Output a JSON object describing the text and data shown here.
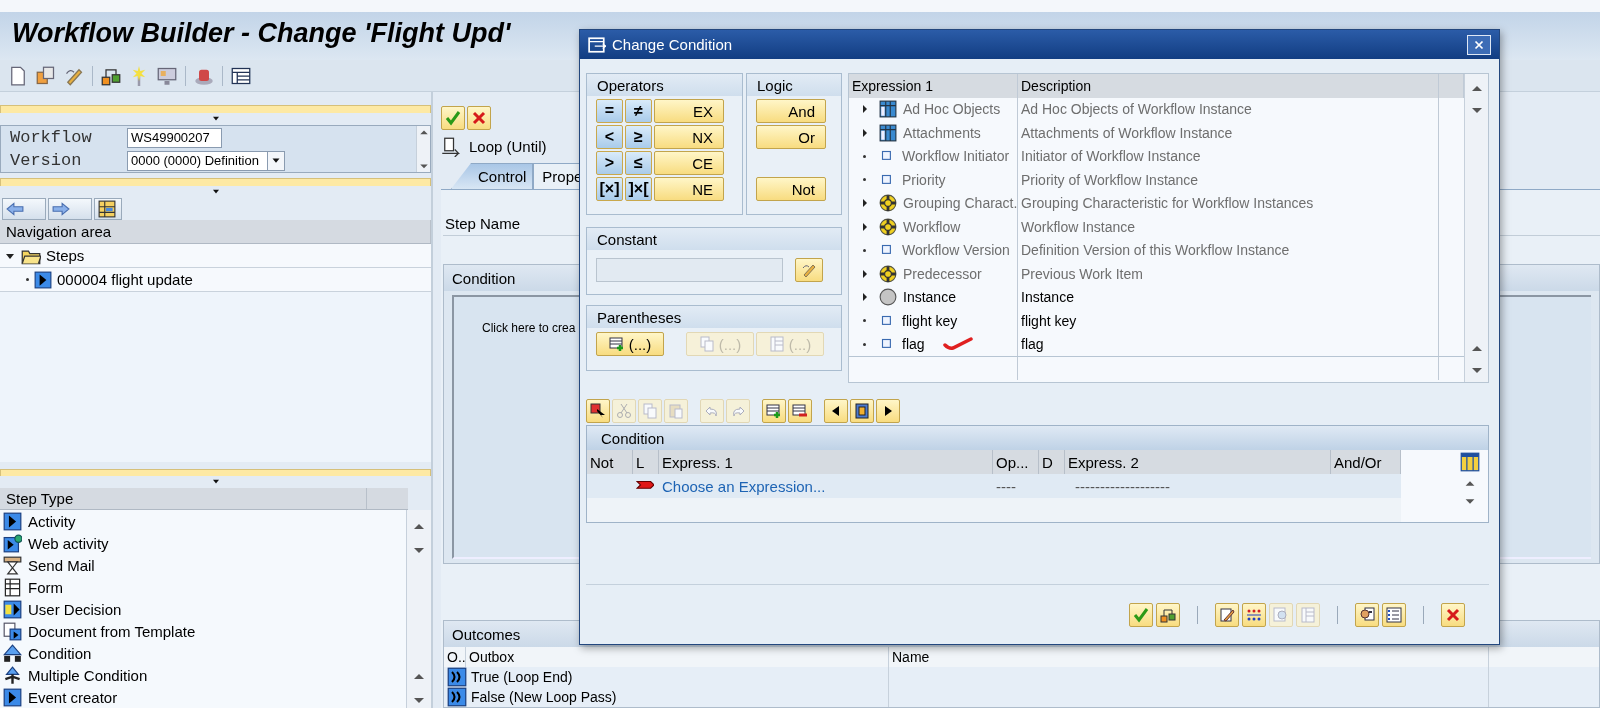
{
  "app_title": "Workflow Builder - Change 'Flight Upd'",
  "left_panel": {
    "form": [
      {
        "label": "Workflow",
        "value": "WS49900207",
        "kind": "text"
      },
      {
        "label": "Version",
        "value": "0000 (0000) Definition",
        "kind": "dropdown"
      }
    ],
    "navigation": {
      "title": "Navigation area",
      "tree": [
        {
          "label": "Steps",
          "expanded": true,
          "children": [
            {
              "label": "000004 flight update"
            }
          ]
        }
      ]
    },
    "step_types": {
      "title": "Step Type",
      "items": [
        "Activity",
        "Web activity",
        "Send Mail",
        "Form",
        "User Decision",
        "Document from Template",
        "Condition",
        "Multiple Condition",
        "Event creator"
      ]
    }
  },
  "detail": {
    "step_title": "Loop (Until)",
    "tabs": [
      {
        "label": "Control",
        "selected": true
      },
      {
        "label": "Prope",
        "selected": false
      }
    ],
    "step_name_label": "Step Name",
    "condition_title": "Condition",
    "condition_hint": "Click here to crea",
    "outcomes": {
      "title": "Outcomes",
      "columns": [
        "O..",
        "Outbox",
        "Name"
      ],
      "rows": [
        "True (Loop End)",
        "False (New Loop Pass)"
      ]
    }
  },
  "dialog": {
    "title": "Change Condition",
    "operators": {
      "title": "Operators",
      "rows": [
        {
          "symbols": [
            "=",
            "≠"
          ],
          "button": "EX"
        },
        {
          "symbols": [
            "<",
            "≥"
          ],
          "button": "NX"
        },
        {
          "symbols": [
            ">",
            "≤"
          ],
          "button": "CE"
        },
        {
          "symbols": [
            "[×]",
            "]×["
          ],
          "button": "NE"
        }
      ]
    },
    "logic": {
      "title": "Logic",
      "buttons": [
        "And",
        "Or",
        "Not"
      ]
    },
    "constant": {
      "title": "Constant"
    },
    "parentheses": {
      "title": "Parentheses",
      "buttons": [
        {
          "label": "(...)",
          "disabled": false
        },
        {
          "label": "(...)",
          "disabled": true
        },
        {
          "label": "(...)",
          "disabled": true
        }
      ]
    },
    "expressions": {
      "columns": [
        "Expression 1",
        "Description"
      ],
      "rows": [
        {
          "label": "Ad Hoc Objects",
          "description": "Ad Hoc Objects of Workflow Instance",
          "kind": "table",
          "has_children": true,
          "disabled": true,
          "marked": false
        },
        {
          "label": "Attachments",
          "description": "Attachments of Workflow Instance",
          "kind": "table",
          "has_children": true,
          "disabled": true,
          "marked": false
        },
        {
          "label": "Workflow Initiator",
          "description": "Initiator of Workflow Instance",
          "kind": "field",
          "has_children": false,
          "disabled": true,
          "marked": false
        },
        {
          "label": "Priority",
          "description": "Priority of Workflow Instance",
          "kind": "field",
          "has_children": false,
          "disabled": true,
          "marked": false
        },
        {
          "label": "Grouping Charact.",
          "description": "Grouping Characteristic for Workflow Instances",
          "kind": "object",
          "has_children": true,
          "disabled": true,
          "marked": false
        },
        {
          "label": "Workflow",
          "description": "Workflow Instance",
          "kind": "object",
          "has_children": true,
          "disabled": true,
          "marked": false
        },
        {
          "label": "Workflow Version",
          "description": "Definition Version of this Workflow Instance",
          "kind": "field",
          "has_children": false,
          "disabled": true,
          "marked": false
        },
        {
          "label": "Predecessor",
          "description": "Previous Work Item",
          "kind": "object",
          "has_children": true,
          "disabled": true,
          "marked": false
        },
        {
          "label": "Instance",
          "description": "Instance",
          "kind": "instance",
          "has_children": true,
          "disabled": false,
          "marked": false
        },
        {
          "label": "flight key",
          "description": "flight key",
          "kind": "field",
          "has_children": false,
          "disabled": false,
          "marked": false
        },
        {
          "label": "flag",
          "description": "flag",
          "kind": "field",
          "has_children": false,
          "disabled": false,
          "marked": true
        }
      ]
    },
    "condition": {
      "title": "Condition",
      "columns": [
        "Not",
        "L",
        "Express. 1",
        "Op...",
        "D",
        "Express. 2",
        "And/Or"
      ],
      "rows": [
        {
          "expression_1": "Choose an Expression...",
          "operator": "----",
          "expression_2": "-------------------"
        }
      ]
    }
  }
}
